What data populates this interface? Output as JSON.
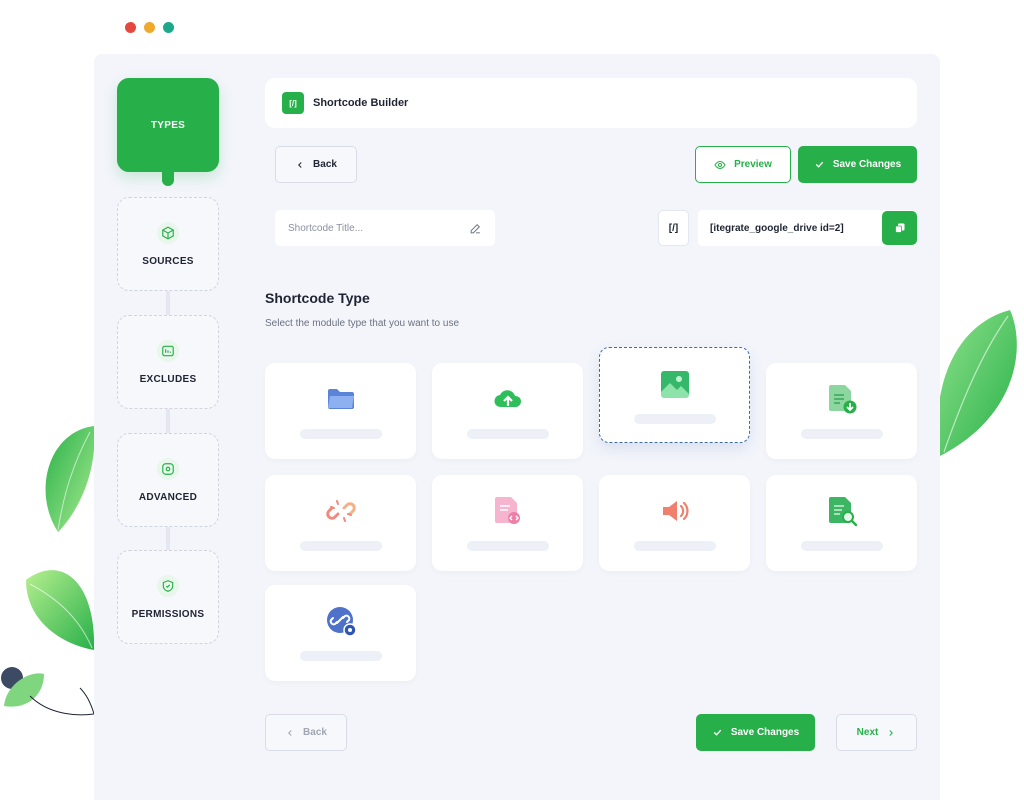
{
  "sidebar": {
    "items": [
      {
        "label": "TYPES",
        "active": true
      },
      {
        "label": "SOURCES",
        "active": false,
        "icon": "cube-icon"
      },
      {
        "label": "EXCLUDES",
        "active": false,
        "icon": "filter-list-icon"
      },
      {
        "label": "ADVANCED",
        "active": false,
        "icon": "gear-squircle-icon"
      },
      {
        "label": "PERMISSIONS",
        "active": false,
        "icon": "shield-check-icon"
      }
    ]
  },
  "header": {
    "badge": "[/]",
    "title": "Shortcode Builder"
  },
  "toolbar": {
    "back_label": "Back",
    "preview_label": "Preview",
    "save_label": "Save Changes"
  },
  "shortcode": {
    "title_placeholder": "Shortcode Title...",
    "tag": "[/]",
    "code": "[itegrate_google_drive id=2]"
  },
  "section": {
    "title": "Shortcode Type",
    "subtitle": "Select the module type that you want to use"
  },
  "modules": [
    {
      "icon": "folder-icon",
      "selected": false
    },
    {
      "icon": "cloud-upload-icon",
      "selected": false
    },
    {
      "icon": "image-gallery-icon",
      "selected": true
    },
    {
      "icon": "file-download-icon",
      "selected": false
    },
    {
      "icon": "broken-link-icon",
      "selected": false
    },
    {
      "icon": "document-embed-icon",
      "selected": false
    },
    {
      "icon": "speaker-icon",
      "selected": false
    },
    {
      "icon": "file-search-icon",
      "selected": false
    },
    {
      "icon": "link-view-icon",
      "selected": false
    }
  ],
  "footer": {
    "back_label": "Back",
    "save_label": "Save Changes",
    "next_label": "Next"
  },
  "colors": {
    "accent": "#27b049",
    "panel": "#f3f5fb",
    "selected_border": "#3b6aa8"
  }
}
